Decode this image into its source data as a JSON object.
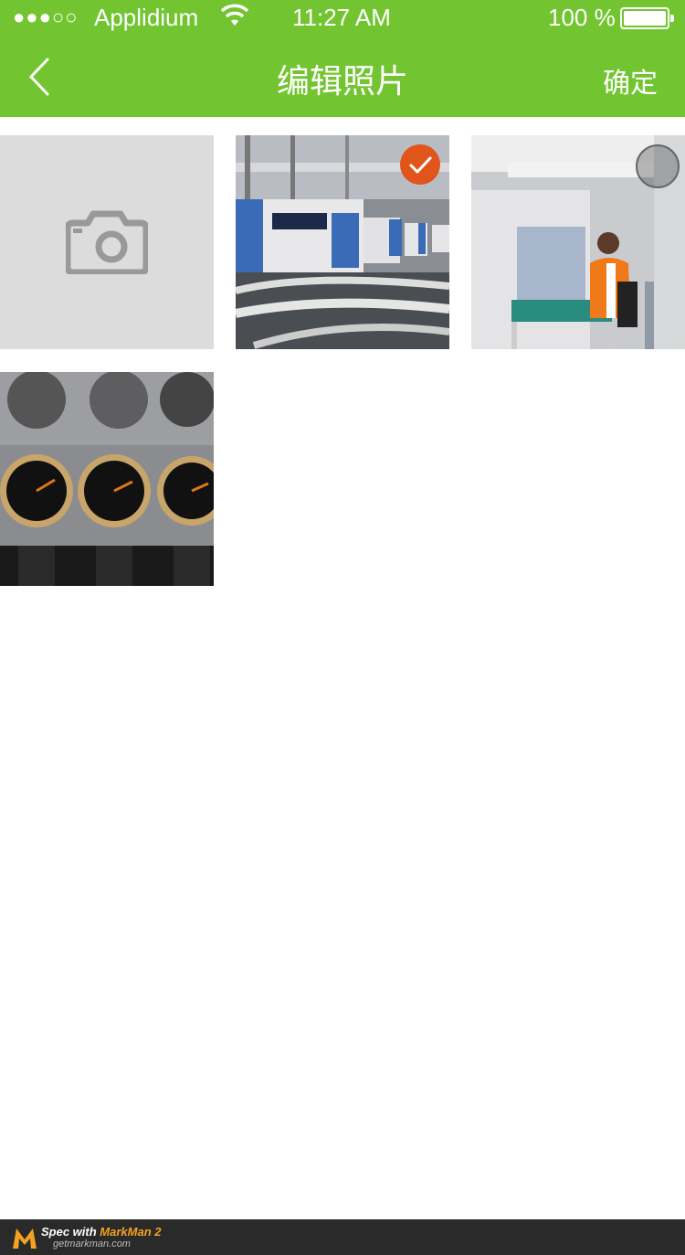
{
  "status_bar": {
    "signal": "●●●○○",
    "carrier": "Applidium",
    "time": "11:27 AM",
    "battery": "100 %"
  },
  "nav": {
    "title": "编辑照片",
    "confirm_label": "确定",
    "back_icon": "chevron-left-icon",
    "background_color": "#72c530"
  },
  "grid": {
    "camera_icon": "camera-icon",
    "photos": [
      {
        "subject": "injection molding machines",
        "selected": true
      },
      {
        "subject": "operator at workstation",
        "selected": false
      },
      {
        "subject": "pressure gauges",
        "selected": null
      }
    ],
    "selected_color": "#e1541a"
  },
  "footer": {
    "line1_prefix": "Spec with ",
    "line1_brand": "MarkMan 2",
    "line2": "getmarkman.com"
  }
}
